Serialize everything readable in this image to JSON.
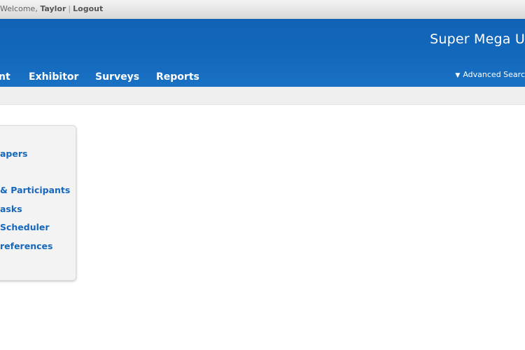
{
  "topbar": {
    "welcome_prefix": "Welcome, ",
    "user_name": "Taylor",
    "separator": "|",
    "logout_label": "Logout"
  },
  "header": {
    "site_title": "Super Mega U",
    "advanced_search_label": "Advanced Searc",
    "nav": [
      "nt",
      "Exhibitor",
      "Surveys",
      "Reports"
    ]
  },
  "sidebar": {
    "links": [
      "apers",
      "& Participants",
      "asks",
      "Scheduler",
      "references"
    ]
  },
  "colors": {
    "header_blue": "#1469bd",
    "link_blue": "#1568bd"
  }
}
